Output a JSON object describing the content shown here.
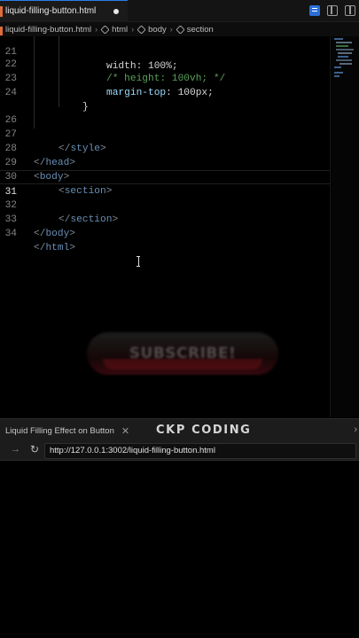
{
  "editor_tab": {
    "title": "liquid-filling-button.html"
  },
  "breadcrumb": {
    "file": "liquid-filling-button.html",
    "items": [
      "html",
      "body",
      "section"
    ]
  },
  "code_lines": [
    {
      "num": "21",
      "segments": [
        {
          "t": "width: 100%;",
          "c": "val"
        }
      ]
    },
    {
      "num": "22",
      "segments": [
        {
          "t": "/* height: 100vh; */",
          "c": "cmt"
        }
      ]
    },
    {
      "num": "23",
      "segments": [
        {
          "t": "margin-top",
          "c": "prop"
        },
        {
          "t": ": 100px;",
          "c": "val"
        }
      ]
    },
    {
      "num": "24",
      "segments": [
        {
          "t": "}",
          "c": "val"
        }
      ]
    },
    {
      "num": "26",
      "segments": []
    },
    {
      "num": "27",
      "segments": [
        {
          "t": "</",
          "c": "brk"
        },
        {
          "t": "style",
          "c": "tag"
        },
        {
          "t": ">",
          "c": "brk"
        }
      ]
    },
    {
      "num": "28",
      "segments": [
        {
          "t": "</",
          "c": "brk"
        },
        {
          "t": "head",
          "c": "tag"
        },
        {
          "t": ">",
          "c": "brk"
        }
      ]
    },
    {
      "num": "29",
      "segments": [
        {
          "t": "<",
          "c": "brk"
        },
        {
          "t": "body",
          "c": "tag"
        },
        {
          "t": ">",
          "c": "brk"
        }
      ]
    },
    {
      "num": "30",
      "segments": [
        {
          "t": "<",
          "c": "brk"
        },
        {
          "t": "section",
          "c": "tag"
        },
        {
          "t": ">",
          "c": "brk"
        }
      ]
    },
    {
      "num": "31",
      "segments": []
    },
    {
      "num": "32",
      "segments": [
        {
          "t": "</",
          "c": "brk"
        },
        {
          "t": "section",
          "c": "tag"
        },
        {
          "t": ">",
          "c": "brk"
        }
      ]
    },
    {
      "num": "33",
      "segments": [
        {
          "t": "</",
          "c": "brk"
        },
        {
          "t": "body",
          "c": "tag"
        },
        {
          "t": ">",
          "c": "brk"
        }
      ]
    },
    {
      "num": "34",
      "segments": [
        {
          "t": "</",
          "c": "brk"
        },
        {
          "t": "html",
          "c": "tag"
        },
        {
          "t": ">",
          "c": "brk"
        }
      ]
    }
  ],
  "ghost_button": {
    "label": "SUBSCRIBE!"
  },
  "browser": {
    "tab_title": "Liquid Filling Effect on Button",
    "url": "http://127.0.0.1:3002/liquid-filling-button.html"
  },
  "brand": "CKP CODING",
  "colors": {
    "tag": "#6a8fb5",
    "comment": "#5aa05a",
    "accent_blue": "#2b7de9",
    "html_file_orange": "#e06c3a",
    "ghost_red": "#8c141e"
  },
  "icons": [
    "accounts-icon",
    "toggle-panel-icon",
    "split-editor-icon",
    "cube-icon",
    "close-icon",
    "arrow-forward-icon",
    "reload-icon",
    "text-cursor-icon"
  ]
}
